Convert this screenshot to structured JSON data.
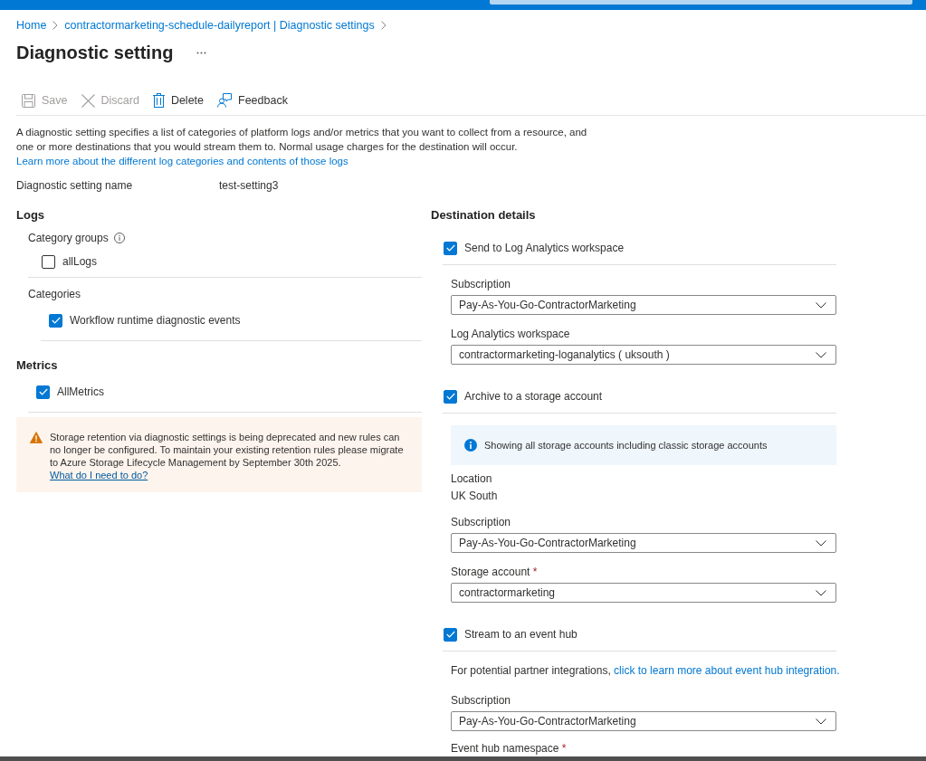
{
  "breadcrumb": [
    {
      "label": "Home"
    },
    {
      "label": "contractormarketing-schedule-dailyreport | Diagnostic settings"
    }
  ],
  "title": "Diagnostic setting",
  "toolbar": [
    {
      "kind": "save",
      "label": "Save",
      "disabled": true
    },
    {
      "kind": "discard",
      "label": "Discard",
      "disabled": true
    },
    {
      "kind": "delete",
      "label": "Delete",
      "disabled": false
    },
    {
      "kind": "feedback",
      "label": "Feedback",
      "disabled": false
    }
  ],
  "description": {
    "text": "A diagnostic setting specifies a list of categories of platform logs and/or metrics that you want to collect from a resource, and one or more destinations that you would stream them to. Normal usage charges for the destination will occur.",
    "link": "Learn more about the different log categories and contents of those logs"
  },
  "setting_name": {
    "label": "Diagnostic setting name",
    "value": "test-setting3"
  },
  "logs": {
    "title": "Logs",
    "category_groups": {
      "label": "Category groups",
      "items": [
        {
          "label": "allLogs",
          "checked": false
        }
      ]
    },
    "categories": {
      "label": "Categories",
      "items": [
        {
          "label": "Workflow runtime diagnostic events",
          "checked": true
        }
      ]
    }
  },
  "metrics": {
    "title": "Metrics",
    "items": [
      {
        "label": "AllMetrics",
        "checked": true
      }
    ]
  },
  "warning": {
    "text": "Storage retention via diagnostic settings is being deprecated and new rules can no longer be configured. To maintain your existing retention rules please migrate to Azure Storage Lifecycle Management by September 30th 2025.",
    "link": "What do I need to do?"
  },
  "destination": {
    "title": "Destination details",
    "targets": [
      {
        "label": "Send to Log Analytics workspace",
        "checked": true,
        "fields": [
          {
            "kind": "dropdown",
            "label": "Subscription",
            "value": "Pay-As-You-Go-ContractorMarketing"
          },
          {
            "kind": "dropdown",
            "label": "Log Analytics workspace",
            "value": "contractormarketing-loganalytics ( uksouth )"
          }
        ]
      },
      {
        "label": "Archive to a storage account",
        "checked": true,
        "fields": [
          {
            "kind": "info",
            "text": "Showing all storage accounts including classic storage accounts"
          },
          {
            "kind": "static",
            "label": "Location",
            "value": "UK South"
          },
          {
            "kind": "dropdown",
            "label": "Subscription",
            "value": "Pay-As-You-Go-ContractorMarketing"
          },
          {
            "kind": "dropdown",
            "label": "Storage account",
            "required_mark": "*",
            "value": "contractormarketing"
          }
        ]
      },
      {
        "label": "Stream to an event hub",
        "checked": true,
        "fields": [
          {
            "kind": "note",
            "text": "For potential partner integrations,",
            "link": "click to learn more about event hub integration."
          },
          {
            "kind": "dropdown",
            "label": "Subscription",
            "value": "Pay-As-You-Go-ContractorMarketing"
          },
          {
            "kind": "label",
            "label": "Event hub namespace",
            "required_mark": "*"
          }
        ]
      }
    ]
  }
}
